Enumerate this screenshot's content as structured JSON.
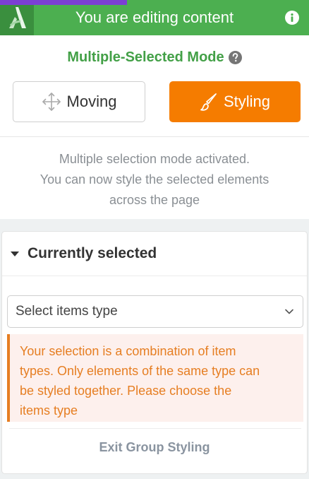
{
  "topbar": {
    "title": "You are editing content",
    "logo_icon": "brand-a-logo-icon",
    "info_icon": "info-icon",
    "color": "#4caf50",
    "accent_color": "#7b3fd4"
  },
  "mode": {
    "title": "Multiple-Selected Mode",
    "help_icon": "question-circle-icon"
  },
  "buttons": {
    "moving": {
      "label": "Moving",
      "icon": "move-arrows-icon"
    },
    "styling": {
      "label": "Styling",
      "icon": "paintbrush-icon",
      "color": "#f57c00"
    }
  },
  "info": {
    "lines": [
      "Multiple selection mode activated.",
      "You can now style the selected elements",
      "across the page"
    ]
  },
  "panel": {
    "title": "Currently selected",
    "select": {
      "value": "Select items type",
      "icon": "chevron-down-icon"
    },
    "warning": {
      "lines": [
        "Your selection is a combination of item",
        "types. Only elements of the same type can",
        "be styled together. Please choose the",
        "items type"
      ],
      "color": "#e67e22"
    },
    "exit_label": "Exit Group Styling"
  }
}
